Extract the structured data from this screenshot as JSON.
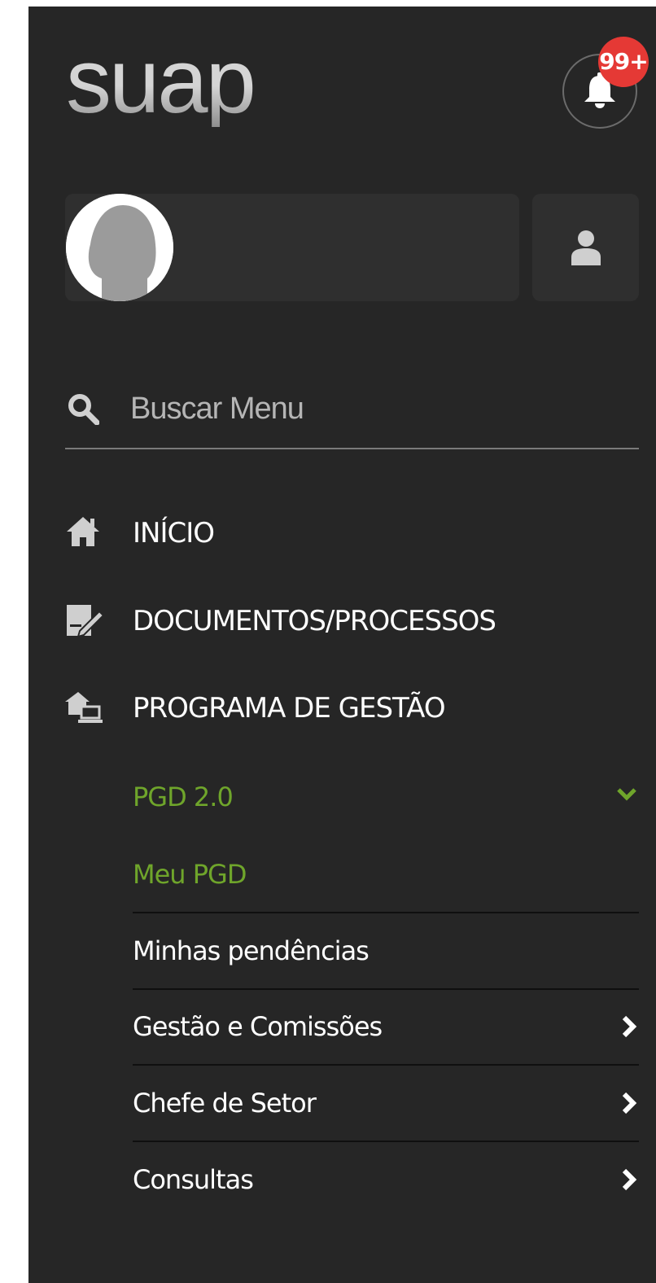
{
  "app": {
    "logo_text": "suap"
  },
  "notifications": {
    "badge_count": "99+"
  },
  "search": {
    "placeholder": "Buscar Menu"
  },
  "menu": {
    "items": [
      {
        "label": "INÍCIO",
        "icon": "home-icon"
      },
      {
        "label": "DOCUMENTOS/PROCESSOS",
        "icon": "document-edit-icon"
      },
      {
        "label": "PROGRAMA DE GESTÃO",
        "icon": "home-office-icon"
      }
    ],
    "submenu": {
      "group_label": "PGD 2.0",
      "group_expanded": true,
      "items": [
        {
          "label": "Meu PGD",
          "active": true
        },
        {
          "label": "Minhas pendências"
        },
        {
          "label": "Gestão e Comissões",
          "has_children": true
        },
        {
          "label": "Chefe de Setor",
          "has_children": true
        },
        {
          "label": "Consultas",
          "has_children": true
        }
      ]
    }
  },
  "colors": {
    "sidebar_bg": "#262626",
    "card_bg": "#2f2f2f",
    "active_green": "#6fa52b",
    "badge_red": "#e53935"
  }
}
